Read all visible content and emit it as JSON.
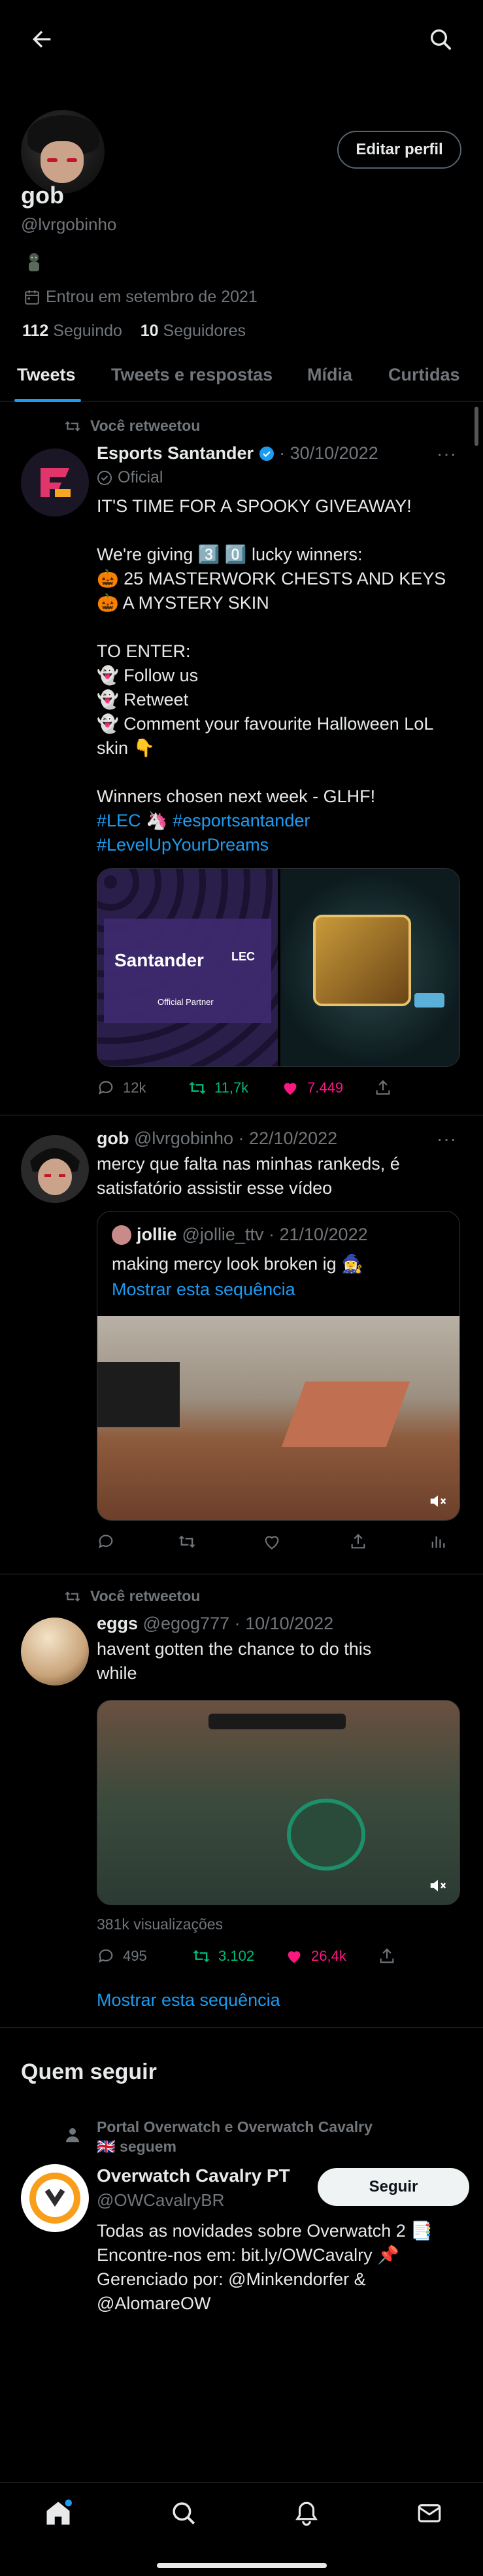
{
  "profile": {
    "name": "gob",
    "handle": "@lvrgobinho",
    "joined": "Entrou em setembro de 2021",
    "following_count": "112",
    "following_label": "Seguindo",
    "followers_count": "10",
    "followers_label": "Seguidores",
    "edit_label": "Editar perfil"
  },
  "tabs": [
    "Tweets",
    "Tweets e respostas",
    "Mídia",
    "Curtidas"
  ],
  "tweets": [
    {
      "retweet_label": "Você retweetou",
      "author": "Esports Santander",
      "meta": "· 30/10/2022",
      "badge": "Oficial",
      "lines": [
        "IT'S TIME FOR A SPOOKY GIVEAWAY!",
        "",
        "We're giving 3️⃣ 0️⃣ lucky winners:",
        "🎃 25 MASTERWORK CHESTS AND KEYS",
        "🎃 A MYSTERY SKIN",
        "",
        "TO ENTER:",
        "👻 Follow us",
        "👻 Retweet",
        "👻 Comment your favourite Halloween LoL",
        "skin 👇",
        "",
        "Winners chosen next week - GLHF!"
      ],
      "tags": [
        "#LEC",
        "#esportsantander",
        "#LevelUpYourDreams"
      ],
      "media_brand": "Santander",
      "media_partner": "Official Partner",
      "media_lec": "LEC",
      "replies": "12k",
      "retweets": "11,7k",
      "likes": "7.449"
    },
    {
      "author": "gob",
      "meta": "@lvrgobinho · 22/10/2022",
      "text_line1": "mercy que falta nas minhas rankeds, é",
      "text_line2": "satisfatório assistir esse vídeo",
      "quote_author": "jollie",
      "quote_meta": "@jollie_ttv · 21/10/2022",
      "quote_text": "making mercy look broken ig 🧙‍♀️",
      "quote_thread": "Mostrar esta sequência"
    },
    {
      "retweet_label": "Você retweetou",
      "author": "eggs",
      "meta": "@egog777 · 10/10/2022",
      "text_line1": "havent gotten the chance to do this",
      "text_line2": "while",
      "views": "381k visualizações",
      "replies": "495",
      "retweets": "3.102",
      "likes": "26,4k",
      "thread": "Mostrar esta sequência"
    }
  ],
  "who_to_follow": {
    "title": "Quem seguir",
    "context_line1": "Portal Overwatch e Overwatch Cavalry",
    "context_line2": "🇬🇧 seguem",
    "name": "Overwatch Cavalry PT",
    "handle": "@OWCavalryBR",
    "follow_label": "Seguir",
    "bio_line1": "Todas as novidades sobre Overwatch 2 📑",
    "bio_line2": "Encontre-nos em: bit.ly/OWCavalry 📌",
    "bio_line3": "Gerenciado por: @Minkendorfer &",
    "bio_line4": "@AlomareOW"
  },
  "colors": {
    "accent": "#1d9bf0",
    "like": "#f91880",
    "retweet": "#00ba7c",
    "background": "#000000"
  }
}
